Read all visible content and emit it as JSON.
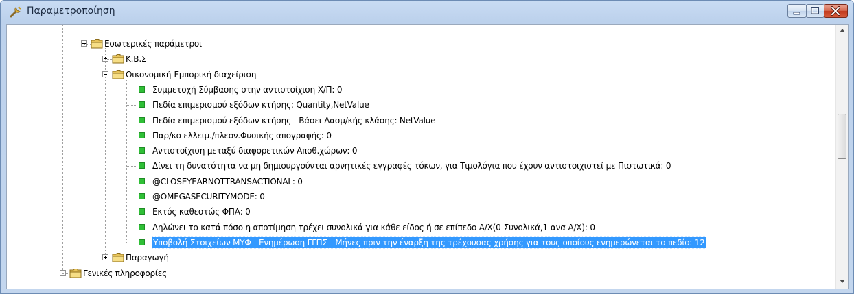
{
  "window": {
    "title": "Παραμετροποίηση",
    "title_icon": "wrench-icon",
    "controls": [
      "minimize-icon",
      "maximize-icon",
      "close-icon"
    ]
  },
  "tree": {
    "nodes": [
      {
        "label": "Εσωτερικές παράμετροι",
        "kind": "folder",
        "expanded": true
      },
      {
        "label": "Κ.Β.Σ",
        "kind": "folder",
        "expanded": false
      },
      {
        "label": "Οικονομική-Εμπορική διαχείριση",
        "kind": "folder",
        "expanded": true
      },
      {
        "label": "Συμμετοχή Σύμβασης στην αντιστοίχιση Χ/Π: 0",
        "kind": "setting"
      },
      {
        "label": "Πεδία επιμερισμού εξόδων κτήσης: Quantity,NetValue",
        "kind": "setting"
      },
      {
        "label": "Πεδία επιμερισμού εξόδων κτήσης - Βάσει Δασμ/κής κλάσης: NetValue",
        "kind": "setting"
      },
      {
        "label": "Παρ/κο ελλειμ./πλεον.Φυσικής απογραφής: 0",
        "kind": "setting"
      },
      {
        "label": "Αντιστοίχιση μεταξύ διαφορετικών Αποθ.χώρων: 0",
        "kind": "setting"
      },
      {
        "label": "Δίνει τη δυνατότητα να μη δημιουργούνται αρνητικές εγγραφές τόκων, για Τιμολόγια που έχουν αντιστοιχιστεί με Πιστωτικά: 0",
        "kind": "setting"
      },
      {
        "label": "@CLOSEYEARNOTTRANSACTIONAL: 0",
        "kind": "setting"
      },
      {
        "label": "@OMEGASECURITYMODE: 0",
        "kind": "setting"
      },
      {
        "label": "Εκτός καθεστώς ΦΠΑ: 0",
        "kind": "setting"
      },
      {
        "label": "Δηλώνει το κατά πόσο η αποτίμηση τρέχει συνολικά για κάθε είδος ή σε επίπεδο Α/Χ(0-Συνολικά,1-ανα Α/Χ): 0",
        "kind": "setting"
      },
      {
        "label": "Υποβολή Στοιχείων ΜΥΦ - Ενημέρωση ΓΓΠΣ - Μήνες πριν την έναρξη της τρέχουσας χρήσης για τους οποίους ενημερώνεται το πεδίο: 12",
        "kind": "setting",
        "selected": true
      },
      {
        "label": "Παραγωγή",
        "kind": "folder",
        "expanded": false
      },
      {
        "label": "Γενικές πληροφορίες",
        "kind": "folder",
        "expanded": true
      }
    ]
  },
  "colors": {
    "selection": "#3399ff",
    "leaf_marker": "#2fbf36",
    "folder": "#f2d36b"
  }
}
